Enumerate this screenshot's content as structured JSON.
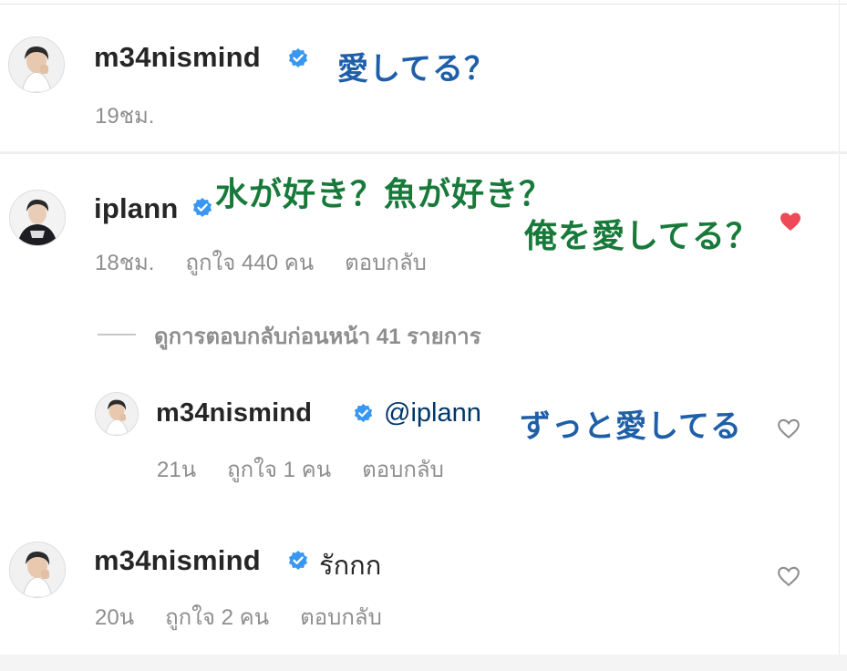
{
  "comments": [
    {
      "username": "m34nismind",
      "verified": true,
      "overlay_text": "愛してる？",
      "time": "19ชม."
    },
    {
      "username": "iplann",
      "verified": true,
      "overlay_line1": "水が好き？魚が好き？",
      "overlay_line2": "俺を愛してる？",
      "time": "18ชม.",
      "likes": "ถูกใจ 440 คน",
      "reply_label": "ตอบกลับ",
      "view_replies": "ดูการตอบกลับก่อนหน้า 41 รายการ",
      "liked": true
    },
    {
      "username": "m34nismind",
      "verified": true,
      "mention": "@iplann",
      "overlay_text": "ずっと愛してる",
      "time": "21น",
      "likes": "ถูกใจ 1 คน",
      "reply_label": "ตอบกลับ"
    },
    {
      "username": "m34nismind",
      "verified": true,
      "text": "รักกก",
      "time": "20น",
      "likes": "ถูกใจ 2 คน",
      "reply_label": "ตอบกลับ"
    }
  ],
  "colors": {
    "verified": "#3897f0",
    "overlay_blue": "#1f5fa8",
    "overlay_green": "#187a3a",
    "liked_heart": "#ed4956",
    "mention": "#00376b",
    "meta": "#8e8e8e"
  },
  "icons": [
    "verified-badge-icon",
    "heart-icon",
    "heart-filled-icon"
  ]
}
